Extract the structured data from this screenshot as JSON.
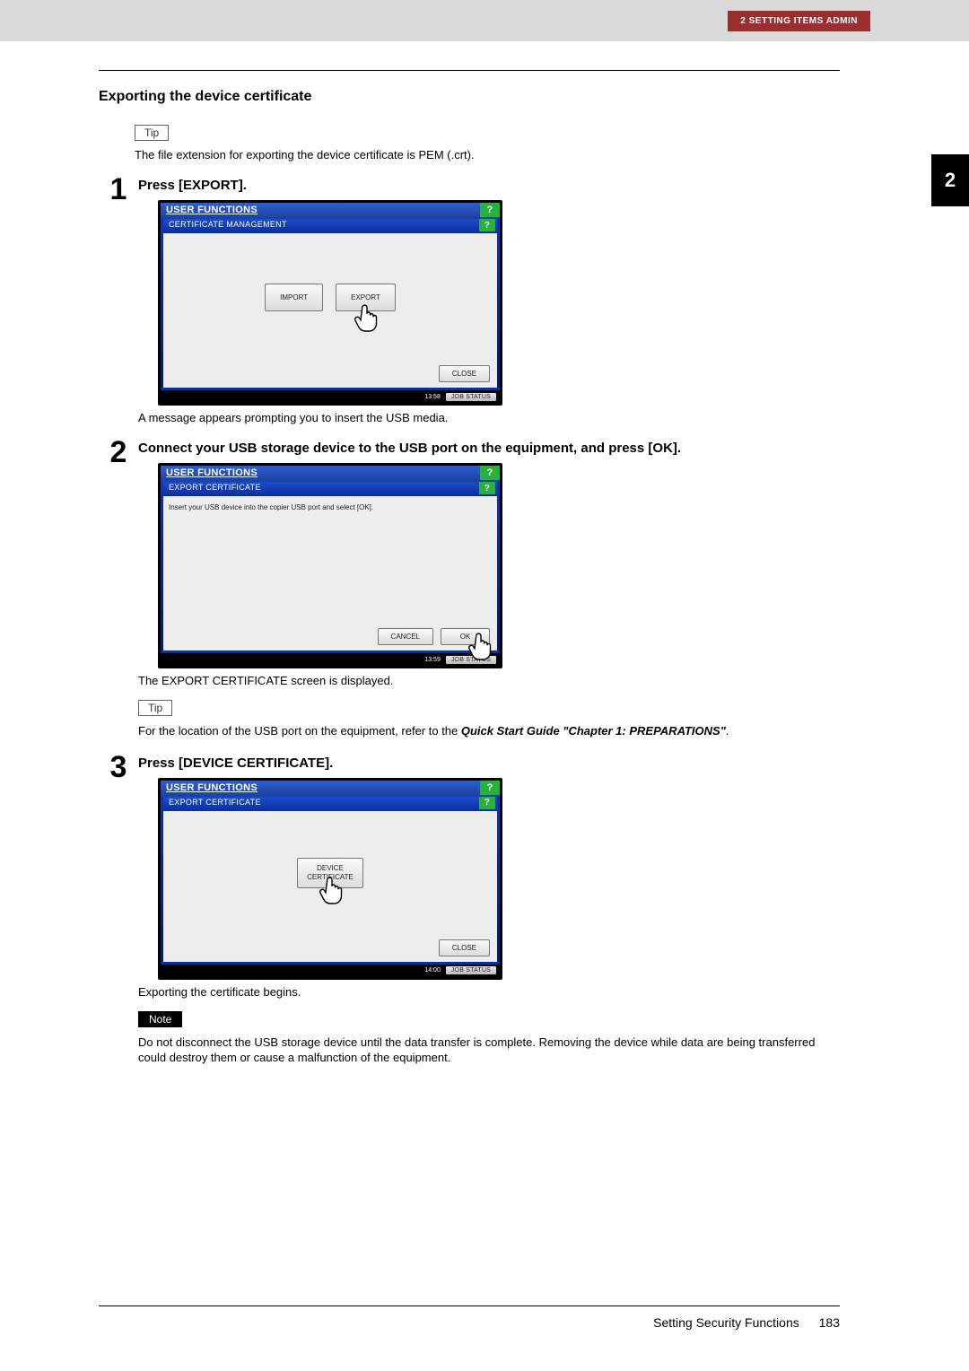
{
  "header": {
    "chapter_tag": "2 SETTING ITEMS ADMIN",
    "thumb_tab": "2"
  },
  "section": {
    "title": "Exporting the device certificate"
  },
  "tip1": {
    "label": "Tip",
    "text": "The file extension for exporting the device certificate is PEM (.crt)."
  },
  "step1": {
    "num": "1",
    "title": "Press [EXPORT].",
    "after": "A message appears prompting you to insert the USB media.",
    "panel": {
      "title": "USER FUNCTIONS",
      "subtitle": "CERTIFICATE MANAGEMENT",
      "btn_import": "IMPORT",
      "btn_export": "EXPORT",
      "btn_close": "CLOSE",
      "time": "13:58",
      "jobstatus": "JOB STATUS"
    }
  },
  "step2": {
    "num": "2",
    "title": "Connect your USB storage device to the USB port on the equipment, and press [OK].",
    "after": "The EXPORT CERTIFICATE screen is displayed.",
    "panel": {
      "title": "USER FUNCTIONS",
      "subtitle": "EXPORT CERTIFICATE",
      "msg": "Insert your USB device into the copier USB port and select [OK].",
      "btn_cancel": "CANCEL",
      "btn_ok": "OK",
      "time": "13:59",
      "jobstatus": "JOB STATUS"
    },
    "tip": {
      "label": "Tip",
      "text_before": "For the location of the USB port on the equipment, refer to the ",
      "ref": "Quick Start Guide \"Chapter 1: PREPARATIONS\"",
      "text_after": "."
    }
  },
  "step3": {
    "num": "3",
    "title": "Press [DEVICE CERTIFICATE].",
    "after": "Exporting the certificate begins.",
    "panel": {
      "title": "USER FUNCTIONS",
      "subtitle": "EXPORT CERTIFICATE",
      "btn_device_l1": "DEVICE",
      "btn_device_l2": "CERTIFICATE",
      "btn_close": "CLOSE",
      "time": "14:00",
      "jobstatus": "JOB STATUS"
    },
    "note": {
      "label": "Note",
      "text": "Do not disconnect the USB storage device until the data transfer is complete. Removing the device while data are being transferred could destroy them or cause a malfunction of the equipment."
    }
  },
  "footer": {
    "section": "Setting Security Functions",
    "page": "183"
  }
}
